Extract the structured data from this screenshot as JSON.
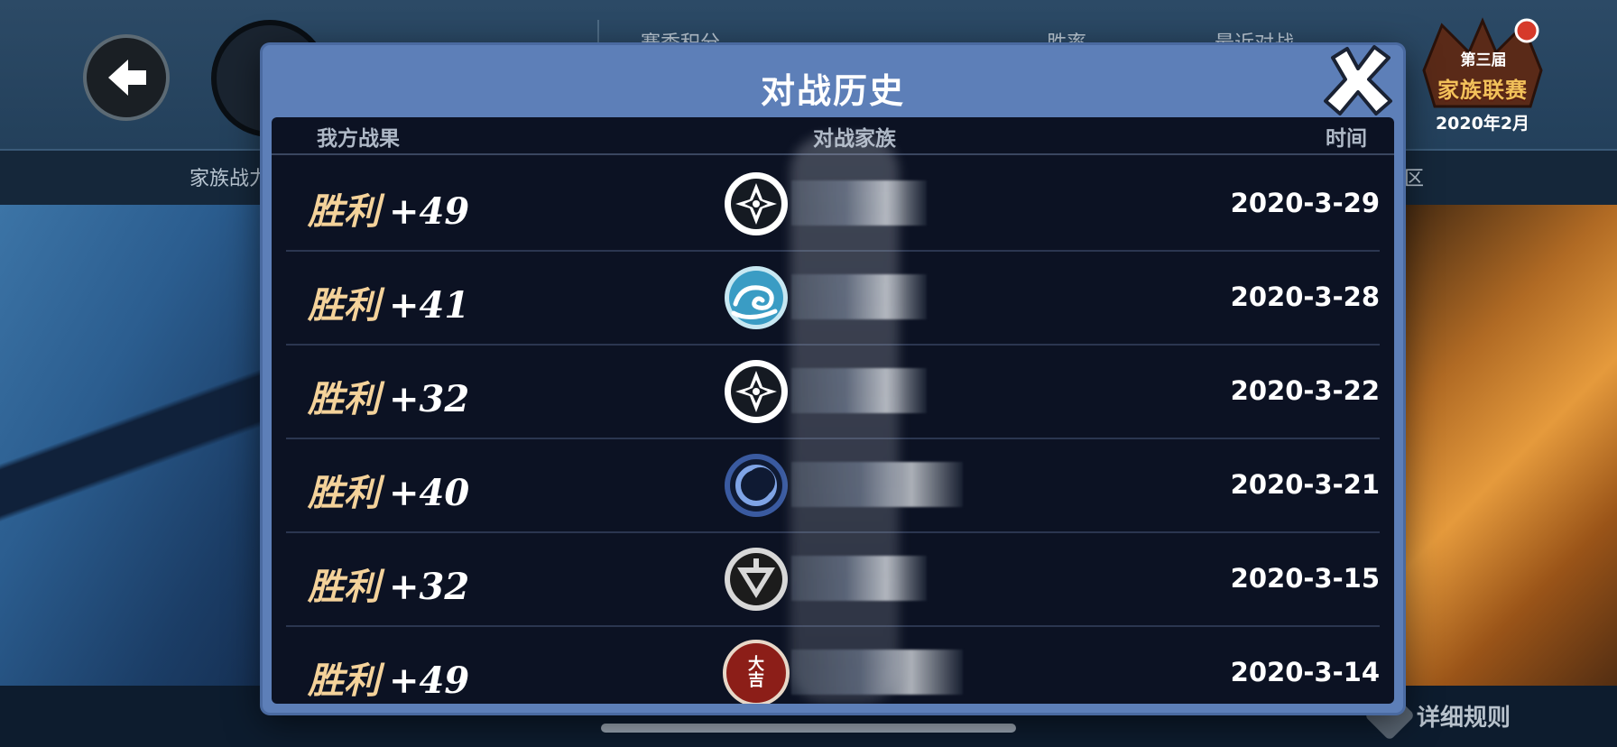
{
  "background": {
    "header_labels": {
      "season_points": "赛季积分",
      "win_rate": "胜率",
      "recent_battles": "最近对战"
    },
    "tabs": {
      "clan_power": "家族战力",
      "region": "区"
    },
    "event_badge": {
      "edition": "第三届",
      "title": "家族联赛",
      "date": "2020年2月"
    },
    "rules_link": "详细规则"
  },
  "modal": {
    "title": "对战历史",
    "columns": {
      "result": "我方战果",
      "opponent": "对战家族",
      "time": "时间"
    },
    "rows": [
      {
        "result": "胜利",
        "points": "+49",
        "opponent_icon": "shuriken-emblem",
        "date": "2020-3-29"
      },
      {
        "result": "胜利",
        "points": "+41",
        "opponent_icon": "swirl-wave-emblem",
        "date": "2020-3-28"
      },
      {
        "result": "胜利",
        "points": "+32",
        "opponent_icon": "shuriken-emblem",
        "date": "2020-3-22"
      },
      {
        "result": "胜利",
        "points": "+40",
        "opponent_icon": "crescent-emblem",
        "date": "2020-3-21"
      },
      {
        "result": "胜利",
        "points": "+32",
        "opponent_icon": "triangle-kunai-emblem",
        "date": "2020-3-15"
      },
      {
        "result": "胜利",
        "points": "+49",
        "opponent_icon": "daikichi-emblem",
        "icon_text": "大吉",
        "date": "2020-3-14"
      }
    ]
  },
  "colors": {
    "modal_frame": "#5d7fb8",
    "panel_bg": "#0c1223",
    "win_text": "#f4d29a"
  }
}
